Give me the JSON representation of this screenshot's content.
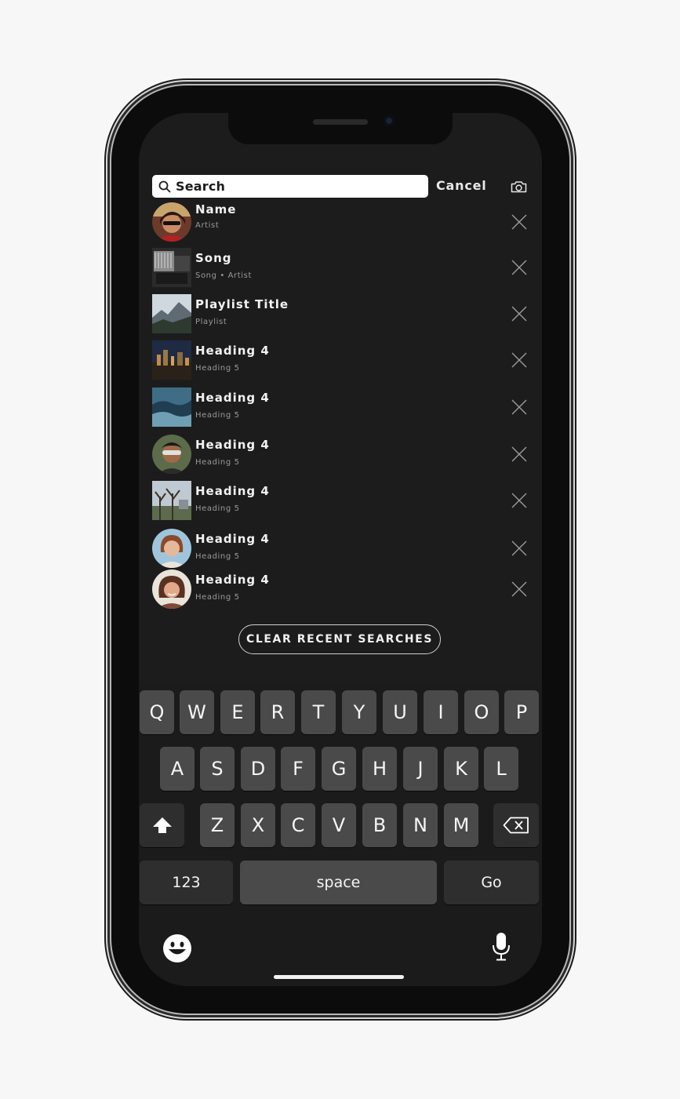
{
  "search": {
    "placeholder": "Search",
    "cancel_label": "Cancel"
  },
  "recent": [
    {
      "title": "Name",
      "subtitle": "Artist",
      "shape": "circle"
    },
    {
      "title": "Song",
      "subtitle": "Song • Artist",
      "shape": "square"
    },
    {
      "title": "Playlist Title",
      "subtitle": "Playlist",
      "shape": "square"
    },
    {
      "title": "Heading 4",
      "subtitle": "Heading 5",
      "shape": "square"
    },
    {
      "title": "Heading 4",
      "subtitle": "Heading 5",
      "shape": "square"
    },
    {
      "title": "Heading 4",
      "subtitle": "Heading 5",
      "shape": "circle"
    },
    {
      "title": "Heading 4",
      "subtitle": "Heading 5",
      "shape": "square"
    },
    {
      "title": "Heading 4",
      "subtitle": "Heading 5",
      "shape": "circle"
    },
    {
      "title": "Heading 4",
      "subtitle": "Heading 5",
      "shape": "circle"
    }
  ],
  "clear_label": "CLEAR RECENT SEARCHES",
  "keyboard": {
    "row1": [
      "Q",
      "W",
      "E",
      "R",
      "T",
      "Y",
      "U",
      "I",
      "O",
      "P"
    ],
    "row2": [
      "A",
      "S",
      "D",
      "F",
      "G",
      "H",
      "J",
      "K",
      "L"
    ],
    "row3": [
      "Z",
      "X",
      "C",
      "V",
      "B",
      "N",
      "M"
    ],
    "numbers_label": "123",
    "space_label": "space",
    "go_label": "Go"
  },
  "icons": {
    "search": "search-icon",
    "camera": "camera-icon",
    "remove": "close-icon",
    "shift": "shift-icon",
    "delete": "backspace-icon",
    "emoji": "emoji-icon",
    "mic": "microphone-icon"
  }
}
